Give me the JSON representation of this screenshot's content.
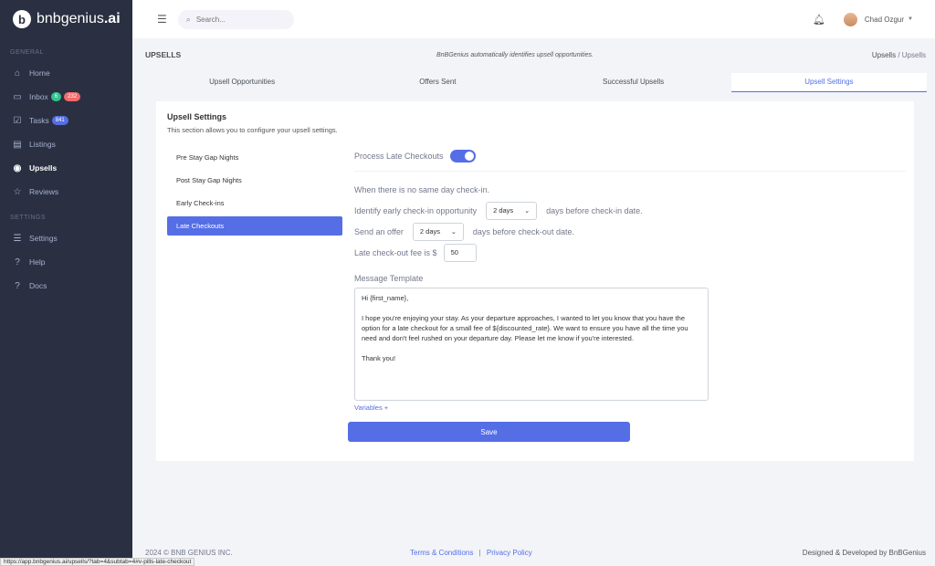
{
  "app": {
    "logo_text": "bnbgenius",
    "logo_suffix": ".ai",
    "logo_letter": "b"
  },
  "sidebar": {
    "section_general": "GENERAL",
    "section_settings": "SETTINGS",
    "items": [
      {
        "label": "Home",
        "icon": "home-icon"
      },
      {
        "label": "Inbox",
        "icon": "inbox-icon",
        "badges": [
          "6",
          "232"
        ]
      },
      {
        "label": "Tasks",
        "icon": "tasks-icon",
        "badges": [
          "841"
        ]
      },
      {
        "label": "Listings",
        "icon": "listings-icon"
      },
      {
        "label": "Upsells",
        "icon": "upsells-icon",
        "active": true
      },
      {
        "label": "Reviews",
        "icon": "star-icon"
      },
      {
        "label": "Settings",
        "icon": "sliders-icon"
      },
      {
        "label": "Help",
        "icon": "help-icon"
      },
      {
        "label": "Docs",
        "icon": "docs-icon"
      }
    ]
  },
  "header": {
    "search_placeholder": "Search...",
    "user_name": "Chad Ozgur"
  },
  "page": {
    "title": "UPSELLS",
    "hint": "BnBGenius automatically identifies upsell opportunities.",
    "breadcrumb": [
      "Upsells",
      "Upsells"
    ]
  },
  "tabs": [
    {
      "label": "Upsell Opportunities"
    },
    {
      "label": "Offers Sent"
    },
    {
      "label": "Successful Upsells"
    },
    {
      "label": "Upsell Settings",
      "active": true
    }
  ],
  "card": {
    "title": "Upsell Settings",
    "subtitle": "This section allows you to configure your upsell settings."
  },
  "pills": [
    {
      "label": "Pre Stay Gap Nights"
    },
    {
      "label": "Post Stay Gap Nights"
    },
    {
      "label": "Early Check-ins"
    },
    {
      "label": "Late Checkouts",
      "active": true
    }
  ],
  "late_checkout": {
    "toggle_label": "Process Late Checkouts",
    "toggle_on": true,
    "no_same_day": "When there is no same day check-in.",
    "identify_prefix": "Identify early check-in opportunity",
    "identify_value": "2 days",
    "identify_suffix": "days before check-in date.",
    "offer_prefix": "Send an offer",
    "offer_value": "2 days",
    "offer_suffix": "days before check-out date.",
    "fee_label": "Late check-out fee is $",
    "fee_value": "50",
    "template_label": "Message Template",
    "template_greeting": "Hi {first_name},",
    "template_body": "I hope you're enjoying your stay. As your departure approaches, I wanted to let you know that you have the option for a late checkout for a small fee of ${discounted_rate}. We want to ensure you have all the time you need and don't feel rushed on your departure day. Please let me know if you're interested.",
    "template_closing": "Thank you!",
    "variables_link": "Variables +",
    "save_label": "Save"
  },
  "footer": {
    "copyright": "2024 © BNB GENIUS INC.",
    "terms": "Terms & Conditions",
    "separator": "|",
    "privacy": "Privacy Policy",
    "credit": "Designed & Developed by BnBGenius"
  },
  "status_url": "https://app.bnbgenius.ai/upsells/?tab=4&subtab=4#v-pills-late-checkout",
  "colors": {
    "primary": "#556ee6",
    "sidebar_bg": "#2a3042",
    "badge_green": "#34c38f",
    "badge_red": "#f46a6a"
  }
}
